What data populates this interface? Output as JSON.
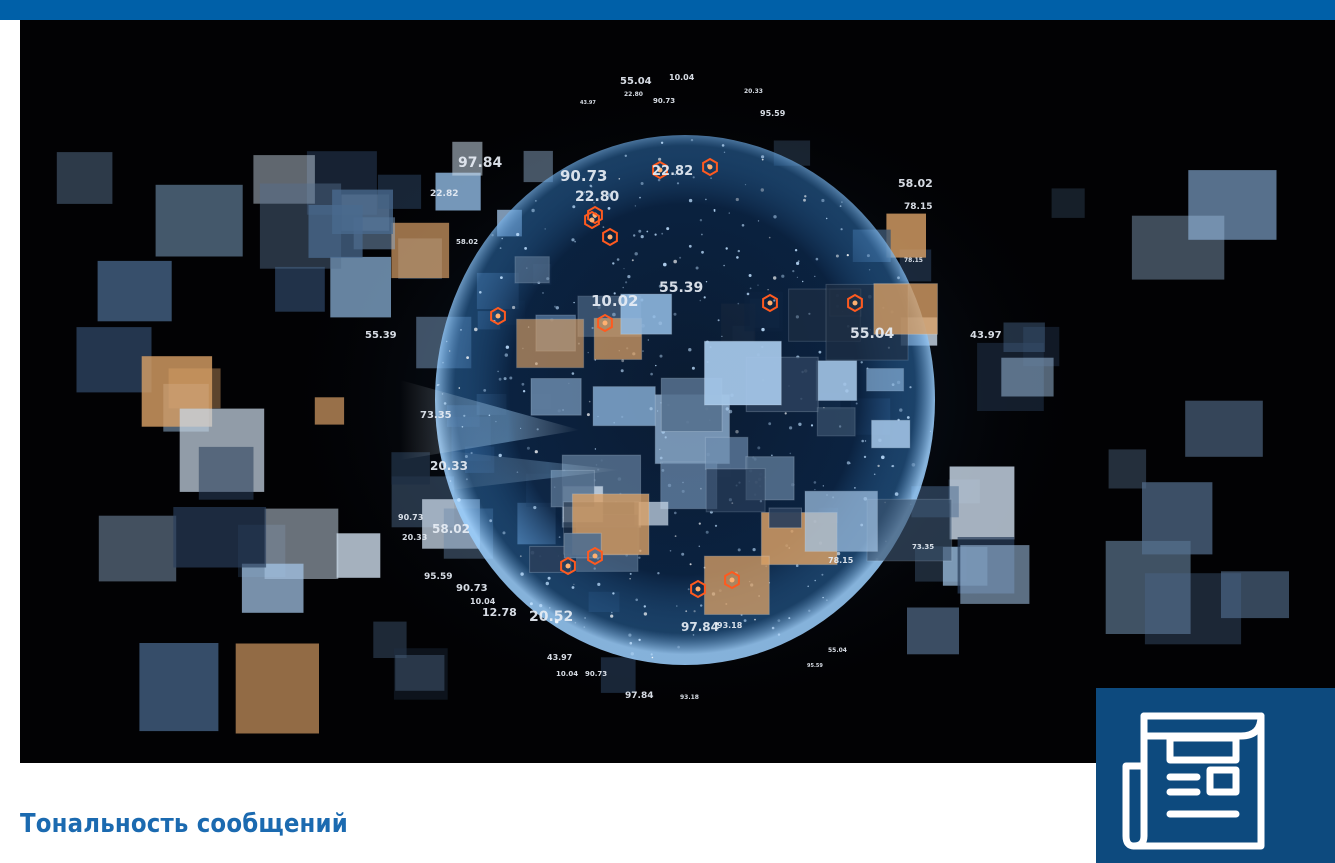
{
  "colors": {
    "accent_bar": "#0060a8",
    "badge_background": "#0d4a7e",
    "title_text": "#1b6ab0",
    "hero_background": "#020204",
    "globe_glow": "#5fa8e8",
    "hotspot": "#ff5a1f"
  },
  "hero": {
    "icon": "digital-globe-media-image",
    "floating_numbers": [
      "55.04",
      "10.04",
      "22.80",
      "90.73",
      "43.97",
      "20.33",
      "95.59",
      "97.84",
      "22.82",
      "90.73",
      "22.80",
      "22.82",
      "58.02",
      "78.15",
      "58.02",
      "78.15",
      "10.02",
      "55.39",
      "55.04",
      "55.39",
      "43.97",
      "73.35",
      "20.33",
      "58.02",
      "90.73",
      "20.33",
      "95.59",
      "90.73",
      "12.78",
      "20.52",
      "97.84",
      "93.18",
      "78.15",
      "73.35",
      "43.97",
      "10.04",
      "90.73",
      "97.84",
      "93.18",
      "55.04",
      "95.59",
      "10.04"
    ]
  },
  "badge": {
    "icon": "newspaper-icon"
  },
  "section": {
    "title": "Тональность сообщений"
  }
}
